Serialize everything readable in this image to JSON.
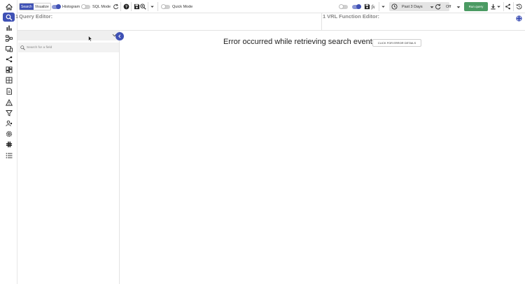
{
  "toolbar": {
    "search_tab": "Search",
    "visualize_tab": "Visualize",
    "histogram_label": "Histogram",
    "sql_mode_label": "SQL Mode",
    "quick_mode_label": "Quick Mode",
    "time_range": "Past 3 Days",
    "refresh_value": "Off",
    "run_query": "Run query"
  },
  "editors": {
    "query_title": "Query Editor:",
    "query_line_no": "1",
    "vrl_title": "VRL Function Editor:",
    "vrl_line_no": "1"
  },
  "fields": {
    "search_placeholder": "Search for a field"
  },
  "results": {
    "error_message": "Error occurred while retrieving search events.",
    "error_details_button": "CLICK FOR ERROR DETAILS"
  },
  "nav": {
    "items": [
      "home-icon",
      "search-icon",
      "bar-chart-icon",
      "pipeline-icon",
      "devices-icon",
      "share-nodes-icon",
      "dashboard-icon",
      "table-icon",
      "report-icon",
      "alert-icon",
      "filter-icon",
      "users-icon",
      "settings-icon",
      "slack-icon",
      "list-icon"
    ]
  },
  "colors": {
    "accent": "#3f51b5",
    "run_button": "#4b9b63"
  }
}
